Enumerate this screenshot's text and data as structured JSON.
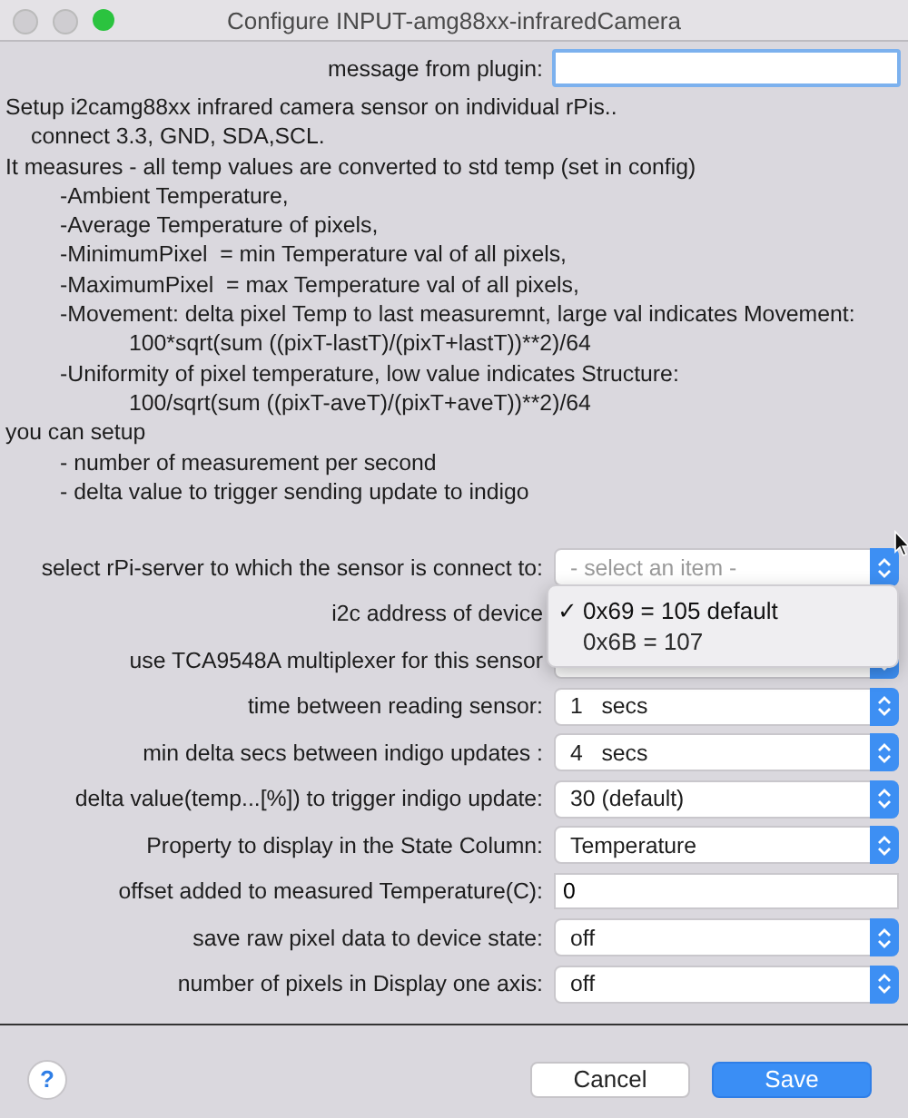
{
  "window": {
    "title": "Configure INPUT-amg88xx-infraredCamera"
  },
  "message": {
    "label": "message from plugin:"
  },
  "description": [
    {
      "kind": "text",
      "text": "Setup i2camg88xx infrared camera sensor on individual rPis.."
    },
    {
      "kind": "note",
      "text": "connect 3.3, GND, SDA,SCL."
    },
    {
      "kind": "text",
      "text": "It measures - all temp values are converted to std temp (set in config)"
    },
    {
      "kind": "item",
      "text": "-Ambient Temperature,"
    },
    {
      "kind": "item",
      "text": "-Average Temperature of pixels,"
    },
    {
      "kind": "item",
      "text": "-MinimumPixel  = min Temperature val of all pixels,"
    },
    {
      "kind": "item",
      "text": "-MaximumPixel  = max Temperature val of all pixels,"
    },
    {
      "kind": "item",
      "text": "-Movement: delta pixel Temp to last measuremnt, large val indicates Movement:"
    },
    {
      "kind": "formula",
      "text": "100*sqrt(sum ((pixT-lastT)/(pixT+lastT))**2)/64"
    },
    {
      "kind": "item",
      "text": "-Uniformity of pixel temperature, low value indicates Structure:"
    },
    {
      "kind": "formula",
      "text": "100/sqrt(sum ((pixT-aveT)/(pixT+aveT))**2)/64"
    },
    {
      "kind": "text",
      "text": "you can setup"
    },
    {
      "kind": "item",
      "text": "- number of measurement per second"
    },
    {
      "kind": "item",
      "text": "- delta value to trigger sending update to indigo"
    }
  ],
  "fields": [
    {
      "kind": "select",
      "label": "select rPi-server to which the sensor is connect to:",
      "placeholder": "- select an item -"
    },
    {
      "kind": "select",
      "label": "i2c address of device"
    },
    {
      "kind": "select",
      "label": "use TCA9548A multiplexer for this sensor"
    },
    {
      "kind": "select",
      "label": "time between reading sensor:",
      "value": "1   secs"
    },
    {
      "kind": "select",
      "label": "min delta secs between indigo updates :",
      "value": "4   secs"
    },
    {
      "kind": "select",
      "label": "delta value(temp...[%]) to trigger indigo update:",
      "value": "30 (default)"
    },
    {
      "kind": "select",
      "label": "Property to display in the State Column:",
      "value": "Temperature"
    },
    {
      "kind": "text",
      "label": "offset added to measured Temperature(C):",
      "value": "0"
    },
    {
      "kind": "select",
      "label": "save raw pixel data to device state:",
      "value": "off"
    },
    {
      "kind": "select",
      "label": "number of pixels in Display one axis:",
      "value": "off"
    }
  ],
  "menu": {
    "check": "✓",
    "options": [
      {
        "label": "0x69 = 105 default",
        "selected": true
      },
      {
        "label": "0x6B = 107",
        "selected": false
      }
    ]
  },
  "buttons": {
    "help": "?",
    "cancel": "Cancel",
    "save": "Save"
  }
}
